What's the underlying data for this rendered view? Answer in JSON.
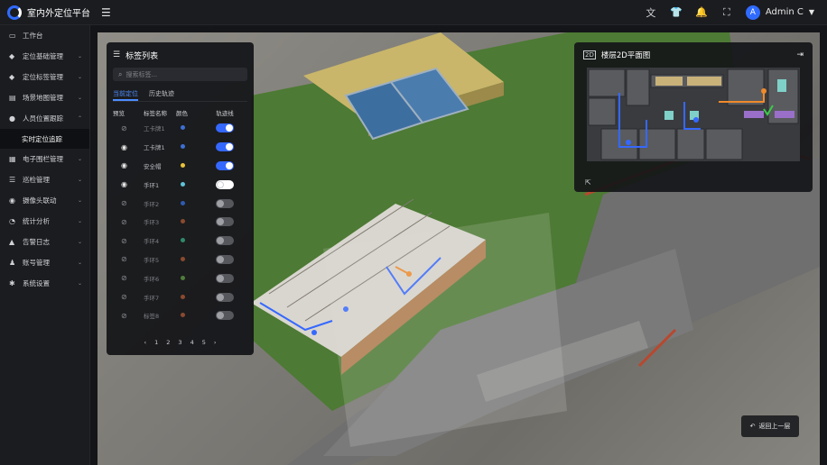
{
  "app": {
    "title": "室内外定位平台"
  },
  "topbar": {
    "icons": [
      "translate-icon",
      "shirt-icon",
      "bell-icon",
      "fullscreen-icon"
    ],
    "user": {
      "avatar_letter": "A",
      "name": "Admin C"
    }
  },
  "sidebar": {
    "items": [
      {
        "label": "工作台",
        "icon": "monitor-icon"
      },
      {
        "label": "定位基础管理",
        "icon": "tag-icon"
      },
      {
        "label": "定位标签管理",
        "icon": "tag-icon"
      },
      {
        "label": "场景地图管理",
        "icon": "map-icon"
      },
      {
        "label": "人员位置跟踪",
        "icon": "person-icon"
      },
      {
        "label": "电子围栏管理",
        "icon": "fence-icon"
      },
      {
        "label": "巡检管理",
        "icon": "checklist-icon"
      },
      {
        "label": "摄像头联动",
        "icon": "camera-icon"
      },
      {
        "label": "统计分析",
        "icon": "pie-icon"
      },
      {
        "label": "告警日志",
        "icon": "alert-icon"
      },
      {
        "label": "账号管理",
        "icon": "user-icon"
      },
      {
        "label": "系统设置",
        "icon": "gear-icon"
      }
    ],
    "sub_item": "实时定位追踪"
  },
  "tag_panel": {
    "title": "标签列表",
    "search_placeholder": "搜索标签...",
    "tabs": [
      "当前定位",
      "历史轨迹"
    ],
    "columns": [
      "预览",
      "标签名称",
      "颜色",
      "轨迹线"
    ],
    "rows": [
      {
        "name": "工卡牌1",
        "color": "#3d6fd6",
        "visible": false,
        "track": "on"
      },
      {
        "name": "工卡牌1",
        "color": "#3d6fd6",
        "visible": true,
        "track": "on"
      },
      {
        "name": "安全帽",
        "color": "#e8c33a",
        "visible": true,
        "track": "on"
      },
      {
        "name": "手环1",
        "color": "#5fc3d6",
        "visible": true,
        "track": "white"
      },
      {
        "name": "手环2",
        "color": "#2f5bb0",
        "visible": false,
        "track": "off"
      },
      {
        "name": "手环3",
        "color": "#8a4a2f",
        "visible": false,
        "track": "off"
      },
      {
        "name": "手环4",
        "color": "#2f8a6a",
        "visible": false,
        "track": "off"
      },
      {
        "name": "手环5",
        "color": "#8a4a2f",
        "visible": false,
        "track": "off"
      },
      {
        "name": "手环6",
        "color": "#4f7d3a",
        "visible": false,
        "track": "off"
      },
      {
        "name": "手环7",
        "color": "#8a4a2f",
        "visible": false,
        "track": "off"
      },
      {
        "name": "标签8",
        "color": "#8a4a2f",
        "visible": false,
        "track": "off"
      }
    ],
    "pagination": [
      "‹",
      "1",
      "2",
      "3",
      "4",
      "5",
      "›"
    ]
  },
  "floor_panel": {
    "title": "楼层2D平面图",
    "badge": "2D"
  },
  "back_button": {
    "label": "返回上一层"
  }
}
